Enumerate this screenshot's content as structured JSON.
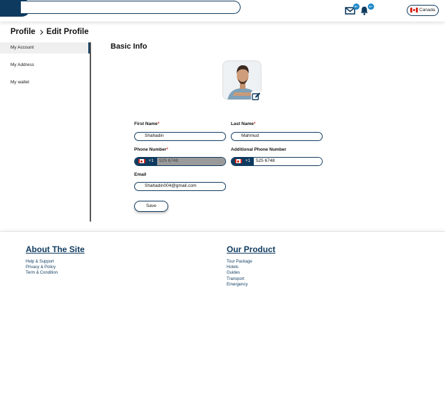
{
  "header": {
    "mail_badge": "9+",
    "notif_badge": "9+",
    "country": "Canada"
  },
  "breadcrumb": {
    "parent": "Profile",
    "current": "Edit Profile"
  },
  "sidebar": {
    "items": [
      {
        "label": "My Account"
      },
      {
        "label": "My Address"
      },
      {
        "label": "My wallet"
      }
    ]
  },
  "main": {
    "title": "Basic Info",
    "first_name_label": "First Name",
    "first_name_value": "Shahadin",
    "last_name_label": "Last Name",
    "last_name_value": "Mahmud",
    "required_mark": "*",
    "phone_label": "Phone Number",
    "phone_code": "+1",
    "phone_value": "525 6748",
    "alt_phone_label": "Additional Phone Number",
    "alt_phone_code": "+1",
    "alt_phone_value": "525 6748",
    "email_label": "Email",
    "email_value": "Shahadin004@gmail.com",
    "save_label": "Save"
  },
  "footer": {
    "about_title": "About The Site",
    "about_links": [
      "Help & Support",
      "Privacy & Policy",
      "Term & Condition"
    ],
    "product_title": "Our Product",
    "product_links": [
      "Tour Package",
      "Hotels",
      "Guides",
      "Transport",
      "Emergency"
    ]
  },
  "colors": {
    "primary": "#0e3a5f",
    "badge": "#1e88c8",
    "required": "#d52b1e",
    "disabled_field": "#9a9a9a"
  },
  "icons": [
    "logo-icon",
    "mail-icon",
    "bell-icon",
    "canada-flag-icon",
    "edit-icon"
  ]
}
